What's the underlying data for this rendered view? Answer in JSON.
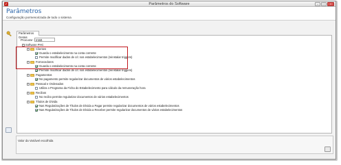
{
  "window": {
    "title": "Parâmetros do Software"
  },
  "banner": {
    "title": "Parâmetros",
    "subtitle": "Configuração pormenorizada de todo o sistema"
  },
  "tab": {
    "label": "Parâmetros Gerais"
  },
  "search": {
    "label": "Procurar :",
    "value": "mtstt"
  },
  "tree": {
    "root": "Software PHC",
    "clientes": {
      "label": "Clientes",
      "items": [
        "Guarda o estabelecimento na conta corrente",
        "Permite modificar dados de c/c nos estabelecimentos (reinstalar triggers)"
      ]
    },
    "fornecedores": {
      "label": "Fornecedores",
      "items": [
        "Guarda o estabelecimento na conta corrente",
        "Permite modificar dados de c/c nos estabelecimentos (reinstalar triggers)"
      ]
    },
    "pagamentos": {
      "label": "Pagamentos",
      "items": [
        "No pagamento permite regularizar documentos de vários estabelecimentos"
      ]
    },
    "pessoal": {
      "label": "Pessoal e Ordenados",
      "items": [
        "Utiliza o Programa da Ficha do Estabelecimento para cálculo da remuneração hora"
      ]
    },
    "recibos": {
      "label": "Recibos",
      "items": [
        "No recibo permite regularizar documentos de vários estabelecimentos"
      ]
    },
    "titulos": {
      "label": "Títulos de Dívida",
      "items": [
        "Nas Regularizações de Títulos de Dívida a Pagar permite regularizar documentos de vários estabelecimentos",
        "Nas Regularizações de Títulos de Dívida a Receber permite regularizar documentos de vários estabelecimentos"
      ]
    }
  },
  "status": {
    "text": "Valor da Variável escolhida"
  },
  "colors": {
    "banner_title": "#2a64a8",
    "highlight": "#c0151b",
    "folder": "#f2c94c"
  }
}
